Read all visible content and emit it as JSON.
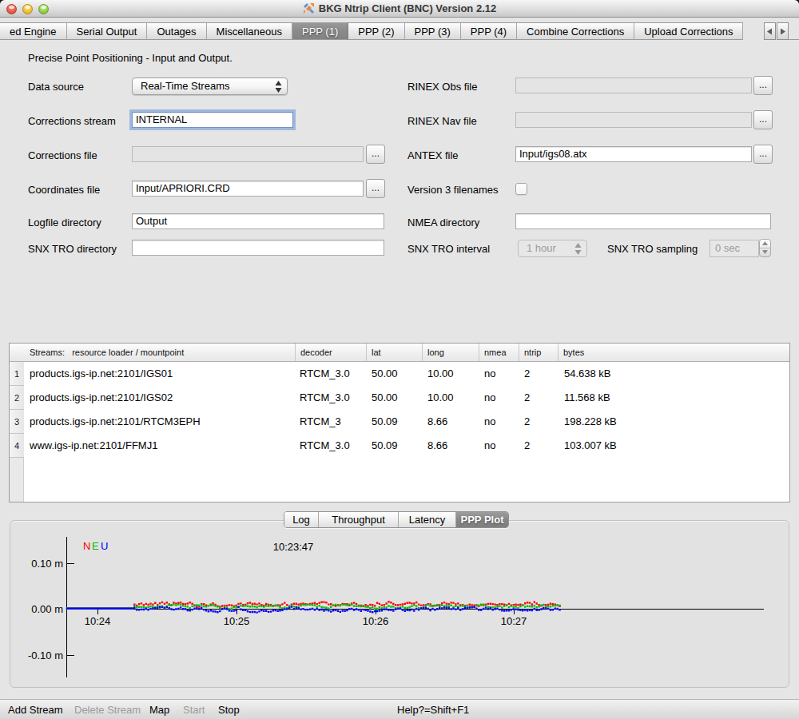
{
  "window": {
    "title": "BKG Ntrip Client (BNC) Version 2.12",
    "traffic_lights": {
      "close": "#ec6b60",
      "minimize": "#f5c93e",
      "zoom": "#9ed858"
    }
  },
  "tabbar": {
    "tabs": [
      {
        "label": "ed Engine",
        "selected": false
      },
      {
        "label": "Serial Output",
        "selected": false
      },
      {
        "label": "Outages",
        "selected": false
      },
      {
        "label": "Miscellaneous",
        "selected": false
      },
      {
        "label": "PPP (1)",
        "selected": true
      },
      {
        "label": "PPP (2)",
        "selected": false
      },
      {
        "label": "PPP (3)",
        "selected": false
      },
      {
        "label": "PPP (4)",
        "selected": false
      },
      {
        "label": "Combine Corrections",
        "selected": false
      },
      {
        "label": "Upload Corrections",
        "selected": false
      }
    ],
    "scroll_arrows": [
      "left",
      "right"
    ]
  },
  "form": {
    "heading": "Precise Point Positioning - Input and Output.",
    "data_source": {
      "label": "Data source",
      "value": "Real-Time Streams"
    },
    "corrections_stream": {
      "label": "Corrections stream",
      "value": "INTERNAL"
    },
    "corrections_file": {
      "label": "Corrections file",
      "value": "",
      "browse": "..."
    },
    "coordinates_file": {
      "label": "Coordinates file",
      "value": "Input/APRIORI.CRD",
      "browse": "..."
    },
    "logfile_directory": {
      "label": "Logfile directory",
      "value": "Output"
    },
    "snx_tro_directory": {
      "label": "SNX TRO directory",
      "value": ""
    },
    "rinex_obs_file": {
      "label": "RINEX Obs file",
      "value": "",
      "browse": "..."
    },
    "rinex_nav_file": {
      "label": "RINEX Nav file",
      "value": "",
      "browse": "..."
    },
    "antex_file": {
      "label": "ANTEX file",
      "value": "Input/igs08.atx",
      "browse": "..."
    },
    "version3_filenames": {
      "label": "Version 3 filenames",
      "checked": false
    },
    "nmea_directory": {
      "label": "NMEA directory",
      "value": ""
    },
    "snx_tro_interval": {
      "label": "SNX TRO interval",
      "value": "1 hour"
    },
    "snx_tro_sampling": {
      "label": "SNX TRO sampling",
      "value": "0 sec"
    }
  },
  "streams_table": {
    "headers": [
      "Streams:   resource loader / mountpoint",
      "decoder",
      "lat",
      "long",
      "nmea",
      "ntrip",
      "bytes"
    ],
    "rows": [
      {
        "num": "1",
        "cells": [
          "products.igs-ip.net:2101/IGS01",
          "RTCM_3.0",
          "50.00",
          "10.00",
          "no",
          "2",
          "54.638 kB"
        ]
      },
      {
        "num": "2",
        "cells": [
          "products.igs-ip.net:2101/IGS02",
          "RTCM_3.0",
          "50.00",
          "10.00",
          "no",
          "2",
          "11.568 kB"
        ]
      },
      {
        "num": "3",
        "cells": [
          "products.igs-ip.net:2101/RTCM3EPH",
          "RTCM_3",
          "50.09",
          "8.66",
          "no",
          "2",
          "198.228 kB"
        ]
      },
      {
        "num": "4",
        "cells": [
          "www.igs-ip.net:2101/FFMJ1",
          "RTCM_3.0",
          "50.09",
          "8.66",
          "no",
          "2",
          "103.007 kB"
        ]
      }
    ]
  },
  "bottom_tabs": {
    "tabs": [
      {
        "label": "Log",
        "selected": false
      },
      {
        "label": "Throughput",
        "selected": false
      },
      {
        "label": "Latency",
        "selected": false
      },
      {
        "label": "PPP Plot",
        "selected": true
      }
    ]
  },
  "chart_data": {
    "type": "scatter",
    "title": "",
    "time_marker": "10:23:47",
    "legend": [
      {
        "name": "N",
        "color": "#ff0000"
      },
      {
        "name": "E",
        "color": "#00bb00"
      },
      {
        "name": "U",
        "color": "#0000ff"
      }
    ],
    "ylabel_unit": "m",
    "y_ticks": [
      {
        "label": "0.10 m",
        "value": 0.1
      },
      {
        "label": "0.00 m",
        "value": 0.0
      },
      {
        "label": "-0.10 m",
        "value": -0.1
      }
    ],
    "ylim": [
      -0.16,
      0.16
    ],
    "x_ticks": [
      "10:24",
      "10:25",
      "10:26",
      "10:27"
    ],
    "x_start_time": "10:23:47",
    "x_end_time": "10:27:20",
    "grid": false,
    "legend_position": "top-left",
    "series_behavior": [
      {
        "name": "N",
        "color": "#ff0000",
        "flat_zero_until": "10:24:32",
        "mean_m": 0.009,
        "noise_m": 0.004
      },
      {
        "name": "E",
        "color": "#00bb00",
        "flat_zero_until": "10:24:32",
        "mean_m": 0.002,
        "noise_m": 0.003
      },
      {
        "name": "U",
        "color": "#0000ff",
        "flat_zero_until": "10:24:32",
        "mean_m": -0.001,
        "noise_m": 0.005
      }
    ]
  },
  "statusbar": {
    "items": [
      {
        "label": "Add Stream",
        "enabled": true
      },
      {
        "label": "Delete Stream",
        "enabled": false
      },
      {
        "label": "Map",
        "enabled": true
      },
      {
        "label": "Start",
        "enabled": false
      },
      {
        "label": "Stop",
        "enabled": true
      },
      {
        "label": "Help?=Shift+F1",
        "enabled": true
      }
    ]
  }
}
